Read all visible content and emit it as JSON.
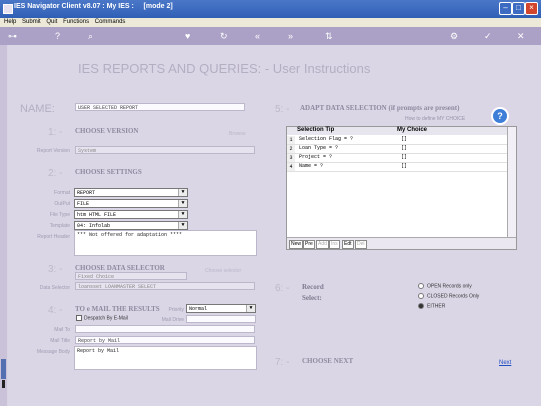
{
  "window": {
    "title": "IES Navigator Client v8.07 : My IES :     [mode 2]"
  },
  "menu": [
    "Help",
    "Submit",
    "Quit",
    "Functions",
    "Commands"
  ],
  "toolbar": {
    "icons": [
      "key-icon",
      "help-icon",
      "search-icon",
      "heart-icon",
      "refresh-icon",
      "back-icon",
      "forward-icon",
      "tree-icon",
      "tools-icon",
      "check-icon",
      "close-icon"
    ]
  },
  "page": {
    "heading": "IES REPORTS AND QUERIES: -   User Instructions"
  },
  "name": {
    "label": "NAME:",
    "value": "USER SELECTED REPORT"
  },
  "s1": {
    "num": "1: -",
    "title": "CHOOSE VERSION",
    "link": "Browse",
    "version_label": "Report Version",
    "version_value": "System"
  },
  "s2": {
    "num": "2: -",
    "title": "CHOOSE SETTINGS",
    "format_label": "Format",
    "format_value": "REPORT",
    "output_label": "OutPut",
    "output_value": "FILE",
    "filetype_label": "File Type",
    "filetype_value": "htm HTML FILE",
    "template_label": "Template",
    "template_value": "04: Infolab",
    "header_label": "Report Header",
    "header_value": "*** Not offered for adaptation ****"
  },
  "s3": {
    "num": "3: -",
    "title": "CHOOSE DATA SELECTOR",
    "link": "Choose selector",
    "fixed": "Fixed Choice",
    "selector_label": "Data Selector",
    "selector_value": "loansset LOANMASTER SELECT"
  },
  "s4": {
    "num": "4: -",
    "title": "TO e MAIL THE RESULTS",
    "priority_label": "Priority",
    "priority_value": "Normal",
    "despatch_label": "Despatch By E-Mail",
    "maildrive_label": "Mail Drive",
    "mailto_label": "Mail To",
    "mailtitle_label": "Mail Title",
    "mailtitle_value": "Report by Mail",
    "body_label": "Message Body",
    "body_value": "Report by Mail"
  },
  "s5": {
    "num": "5: -",
    "title": "ADAPT DATA SELECTION (if prompts are present)",
    "howto": "How to define MY CHOICE",
    "col_tip": "Selection Tip",
    "col_choice": "My Choice",
    "rows": [
      {
        "n": "1",
        "tip": "Selection Flag = ?",
        "choice": "[]"
      },
      {
        "n": "2",
        "tip": "Loan Type = ?",
        "choice": "[]"
      },
      {
        "n": "3",
        "tip": "Project = ?",
        "choice": "[]"
      },
      {
        "n": "4",
        "tip": "Name = ?",
        "choice": "[]"
      }
    ],
    "buttons": [
      "New",
      "Pre",
      "Add",
      "Ins",
      "Edt",
      "Del"
    ]
  },
  "s6": {
    "num": "6: -",
    "record_label": "Record",
    "select_label": "Select:",
    "options": [
      "OPEN Records only",
      "CLOSED Records Only",
      "EITHER"
    ],
    "selected_index": 2
  },
  "s7": {
    "num": "7: -",
    "title": "CHOOSE NEXT",
    "next": "Next"
  }
}
